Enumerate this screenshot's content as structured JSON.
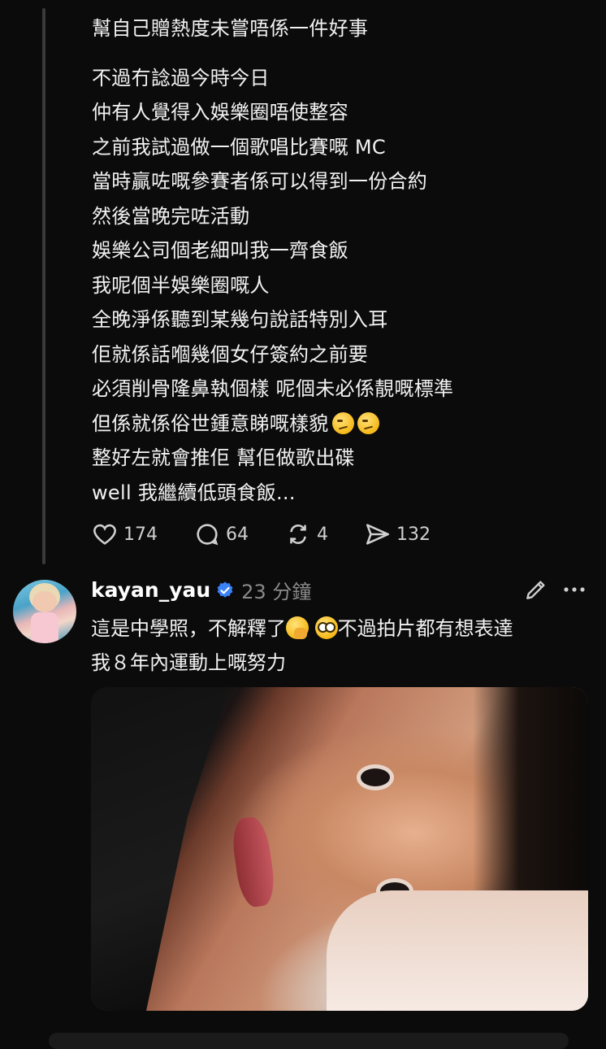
{
  "post1": {
    "lines_a": [
      "幫自己贈熱度未嘗唔係一件好事"
    ],
    "lines_b": [
      "不過冇諗過今時今日",
      "仲有人覺得入娛樂圈唔使整容",
      "之前我試過做一個歌唱比賽嘅 MC",
      "當時贏咗嘅參賽者係可以得到一份合約",
      "然後當晚完咗活動",
      "娛樂公司個老細叫我一齊食飯",
      "我呢個半娛樂圈嘅人",
      "全晚淨係聽到某幾句說話特別入耳",
      "佢就係話嗰幾個女仔簽約之前要",
      "必須削骨隆鼻執個樣 呢個未必係靚嘅標準",
      "但係就係俗世鍾意睇嘅樣貌",
      "整好左就會推佢 幫佢做歌出碟",
      "well 我繼續低頭食飯..."
    ],
    "emoji_line_index": 10,
    "emoji_icons": [
      "raised-eyebrow-emoji",
      "raised-eyebrow-emoji"
    ],
    "likes": "174",
    "comments": "64",
    "reposts": "4",
    "shares": "132"
  },
  "post2": {
    "username": "kayan_yau",
    "time": "23 分鐘",
    "line1_a": "這是中學照，不解釋了",
    "line1_b": "不過拍片都有想表達",
    "line2": "我８年內運動上嘅努力",
    "emoji_icons": [
      "hand-over-mouth-emoji",
      "flushed-face-emoji"
    ]
  },
  "colors": {
    "background": "#0b0b0b",
    "text": "#f2f2f2",
    "muted": "#8a8a8a",
    "verified": "#3b82f6"
  }
}
